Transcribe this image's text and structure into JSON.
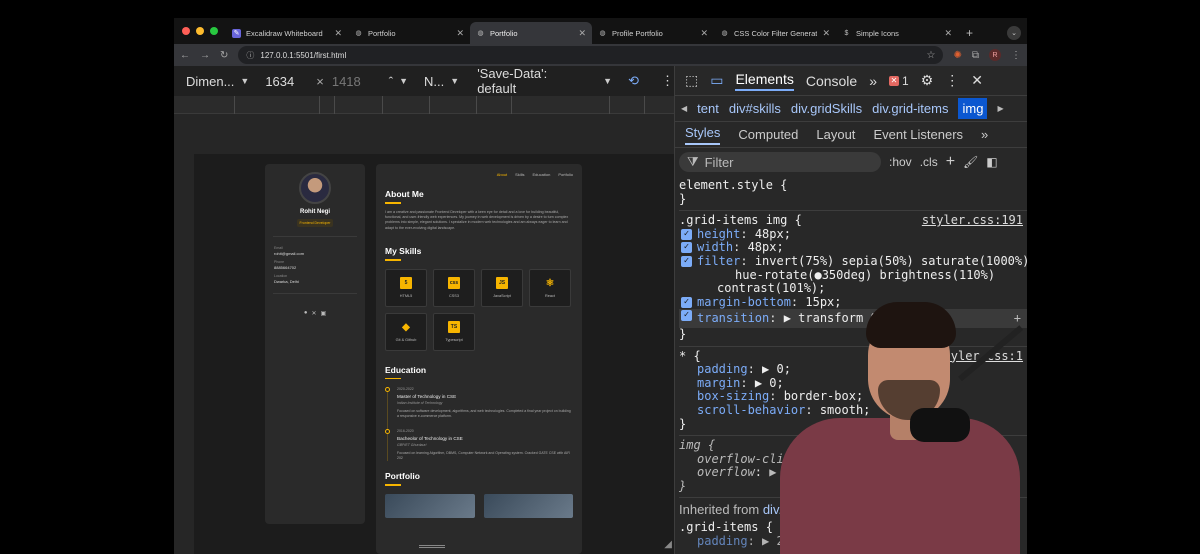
{
  "browser": {
    "tabs": [
      {
        "title": "Excalidraw Whiteboard",
        "active": false,
        "icon": "excalidraw-icon"
      },
      {
        "title": "Portfolio",
        "active": false,
        "icon": "globe-icon"
      },
      {
        "title": "Portfolio",
        "active": true,
        "icon": "globe-icon"
      },
      {
        "title": "Profile Portfolio",
        "active": false,
        "icon": "globe-icon"
      },
      {
        "title": "CSS Color Filter Generato",
        "active": false,
        "icon": "globe-icon"
      },
      {
        "title": "Simple Icons",
        "active": false,
        "icon": "dollar-icon"
      }
    ],
    "url": "127.0.0.1:5501/first.html",
    "profile_initial": "R"
  },
  "device_toolbar": {
    "dimensions": "Dimen...",
    "width": "1634",
    "height": "1418",
    "scale": "ˆ",
    "throttle": "N...",
    "save_data": "'Save-Data': default"
  },
  "portfolio": {
    "name": "Rohit Negi",
    "role": "Frontend Developer",
    "contact": [
      {
        "label": "Email",
        "value": "rohit@gmail.com"
      },
      {
        "label": "Phone",
        "value": "8885664702"
      },
      {
        "label": "Location",
        "value": "Dwarka, Delhi"
      }
    ],
    "nav": [
      "About",
      "Skills",
      "Education",
      "Portfolio"
    ],
    "about_heading": "About Me",
    "about_text": "I am a creative and passionate Frontend Developer with a keen eye for detail and a love for building beautiful, functional, and user-friendly web experiences. My journey in web development is driven by a desire to turn complex problems into simple, elegant solutions. I specialize in modern web technologies and am always eager to learn and adapt to the ever-evolving digital landscape.",
    "skills_heading": "My Skills",
    "skills": [
      {
        "name": "HTML5",
        "badge": "5"
      },
      {
        "name": "CSS3",
        "badge": "css"
      },
      {
        "name": "JavaScript",
        "badge": "JS"
      },
      {
        "name": "React",
        "badge": "⚛"
      },
      {
        "name": "Git & Github",
        "badge": "◆"
      },
      {
        "name": "Typescript",
        "badge": "TS"
      }
    ],
    "education_heading": "Education",
    "education": [
      {
        "years": "2020-2022",
        "degree": "Master of Technology in CSE",
        "school": "Indian Institute of Technology",
        "desc": "Focused on software development, algorithms, and web technologies. Completed a final year project on building a responsive e-commerce platform."
      },
      {
        "years": "2016-2020",
        "degree": "Bacheolor of Technology in CSE",
        "school": "GBPIET Ghurdauri",
        "desc": "Focused on learning Algorithm, DBMS, Computer Network and Operating system. Cracked GATE CSE with AIR 202"
      }
    ],
    "portfolio_heading": "Portfolio"
  },
  "devtools": {
    "main_tabs": [
      "Elements",
      "Console"
    ],
    "error_count": "1",
    "breadcrumbs": [
      "tent",
      "div#skills",
      "div.gridSkills",
      "div.grid-items",
      "img"
    ],
    "sub_tabs": [
      "Styles",
      "Computed",
      "Layout",
      "Event Listeners"
    ],
    "filter_placeholder": "Filter",
    "hov": ":hov",
    "cls": ".cls",
    "element_style": "element.style {",
    "rules": {
      "grid_img_selector": ".grid-items img {",
      "grid_img_source": "styler.css:191",
      "decls": [
        {
          "prop": "height",
          "value": "48px;"
        },
        {
          "prop": "width",
          "value": "48px;"
        },
        {
          "prop": "filter",
          "value": "invert(75%) sepia(50%) saturate(1000%)"
        },
        {
          "prop": "",
          "value": "hue-rotate(●350deg) brightness(110%)"
        },
        {
          "prop": "",
          "value": "contrast(101%);"
        },
        {
          "prop": "margin-bottom",
          "value": "15px;"
        },
        {
          "prop": "transition",
          "value": "▶ transform 0.3s"
        }
      ],
      "star_selector": "* {",
      "star_source": "styler.css:1",
      "star_decls": [
        {
          "prop": "padding",
          "value": "▶ 0;"
        },
        {
          "prop": "margin",
          "value": "▶ 0;"
        },
        {
          "prop": "box-sizing",
          "value": "border-box;"
        },
        {
          "prop": "scroll-behavior",
          "value": "smooth;"
        }
      ],
      "img_selector": "img {",
      "img_decls": [
        {
          "prop": "overflow-clip-margi",
          "value": ""
        },
        {
          "prop": "overflow",
          "value": "▶ clip;"
        }
      ],
      "inherited_label": "Inherited from",
      "inherited_from": "div.g",
      "grid_items_selector": ".grid-items {",
      "grid_items_decl": {
        "prop": "padding",
        "value": "▶ 20"
      }
    }
  },
  "colors": {
    "accent": "#f7b500",
    "devtools_link": "#7cacf8",
    "error": "#e46962"
  }
}
